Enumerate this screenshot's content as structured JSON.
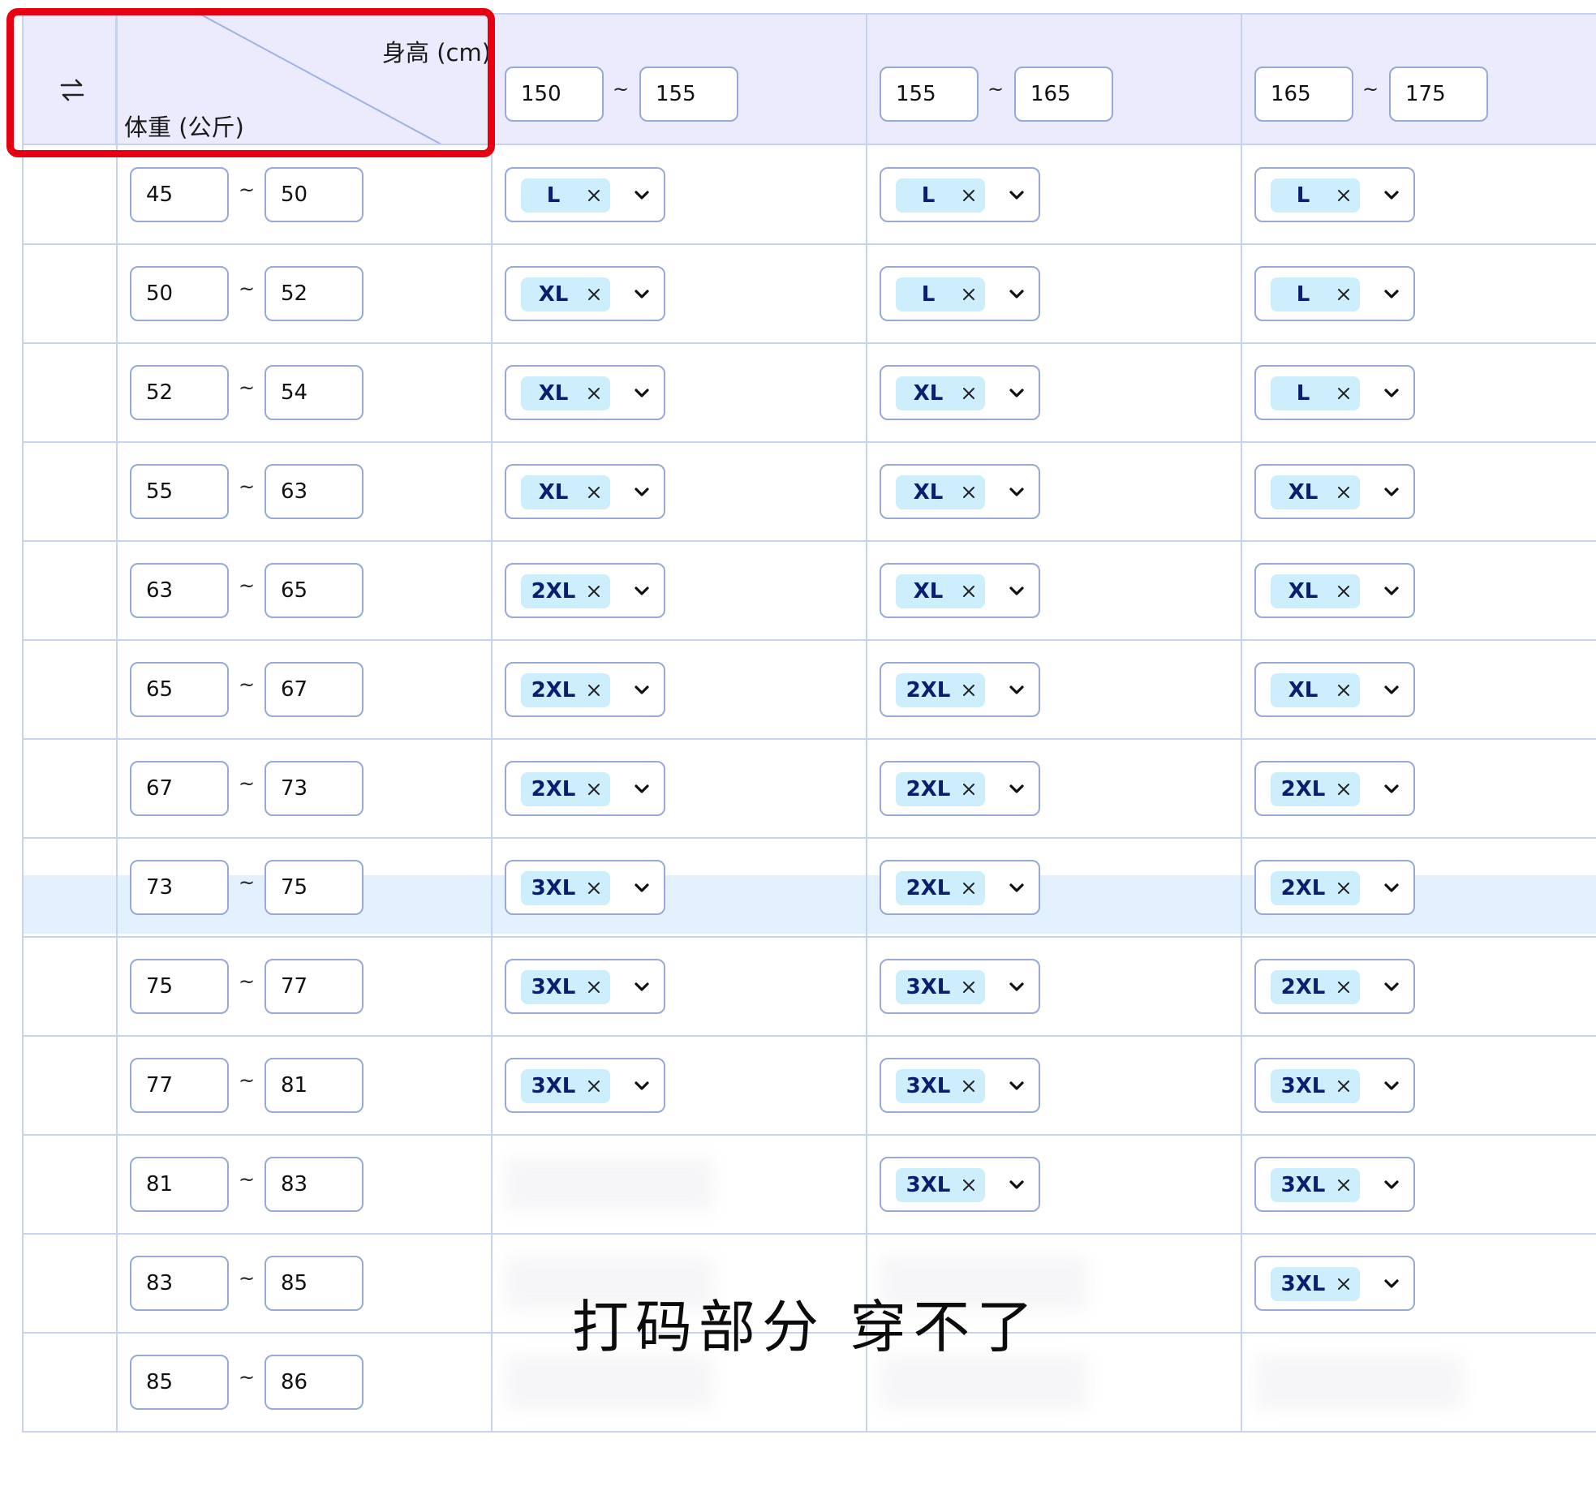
{
  "header": {
    "height_label": "身高 (cm)",
    "weight_label": "体重 (公斤)",
    "height_ranges": [
      {
        "min": "150",
        "max": "155"
      },
      {
        "min": "155",
        "max": "165"
      },
      {
        "min": "165",
        "max": "175"
      }
    ],
    "separator": "~"
  },
  "rows": [
    {
      "min": "45",
      "max": "50",
      "sizes": [
        "L",
        "L",
        "L"
      ]
    },
    {
      "min": "50",
      "max": "52",
      "sizes": [
        "XL",
        "L",
        "L"
      ]
    },
    {
      "min": "52",
      "max": "54",
      "sizes": [
        "XL",
        "XL",
        "L"
      ]
    },
    {
      "min": "55",
      "max": "63",
      "sizes": [
        "XL",
        "XL",
        "XL"
      ]
    },
    {
      "min": "63",
      "max": "65",
      "sizes": [
        "2XL",
        "XL",
        "XL"
      ]
    },
    {
      "min": "65",
      "max": "67",
      "sizes": [
        "2XL",
        "2XL",
        "XL"
      ]
    },
    {
      "min": "67",
      "max": "73",
      "sizes": [
        "2XL",
        "2XL",
        "2XL"
      ]
    },
    {
      "min": "73",
      "max": "75",
      "sizes": [
        "3XL",
        "2XL",
        "2XL"
      ]
    },
    {
      "min": "75",
      "max": "77",
      "sizes": [
        "3XL",
        "3XL",
        "2XL"
      ]
    },
    {
      "min": "77",
      "max": "81",
      "sizes": [
        "3XL",
        "3XL",
        "3XL"
      ]
    },
    {
      "min": "81",
      "max": "83",
      "sizes": [
        null,
        "3XL",
        "3XL"
      ]
    },
    {
      "min": "83",
      "max": "85",
      "sizes": [
        null,
        null,
        "3XL"
      ]
    },
    {
      "min": "85",
      "max": "86",
      "sizes": [
        null,
        null,
        null
      ]
    }
  ],
  "overlay_caption": "打码部分 穿不了",
  "colors": {
    "header_bg": "#ebebfd",
    "tag_bg": "#cdeefc",
    "tag_text": "#0a1e70",
    "border": "#98a8d8",
    "highlight_row": "#e3f1fe",
    "annotation_red": "#e60012"
  }
}
